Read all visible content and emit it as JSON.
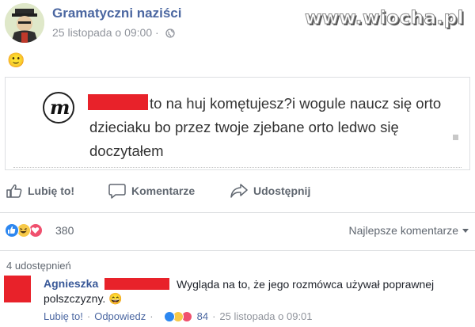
{
  "post": {
    "page_name": "Gramatyczni naziści",
    "date": "25 listopada o 09:00",
    "date_sep": "·",
    "caption": "🙂"
  },
  "watermark": "www.wiocha.pl",
  "embed": {
    "text": "to na huj komętujesz?i wogule naucz się orto dzieciaku bo przez twoje zjebane orto ledwo się doczytałem"
  },
  "actions": {
    "like_label": "Lubię to!",
    "comment_label": "Komentarze",
    "share_label": "Udostępnij"
  },
  "reactions": {
    "count": "380",
    "sort_label": "Najlepsze komentarze"
  },
  "shares_label": "4 udostępnień",
  "comment": {
    "author": "Agnieszka",
    "text": "Wygląda na to, że jego rozmówca używał poprawnej polszczyzny.",
    "emoji": "😄",
    "like_label": "Lubię to!",
    "sep": "·",
    "reply_label": "Odpowiedz",
    "reaction_count": "84",
    "date": "25 listopada o 09:01"
  },
  "colors": {
    "link_blue": "#4b67a1",
    "redaction_red": "#e8222a",
    "like_blue": "#2d87f0",
    "haha_yellow": "#f7c948",
    "love_red": "#f0506e"
  }
}
